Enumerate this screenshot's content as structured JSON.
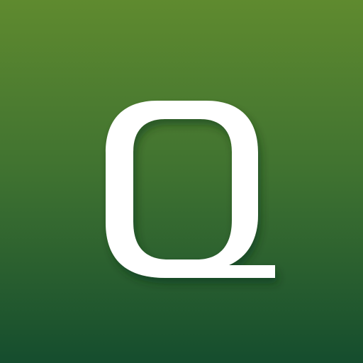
{
  "app_icon": {
    "letter": "Q",
    "icon_name": "q-letter-icon",
    "colors": {
      "background_top": "#5f8a2f",
      "background_middle": "#3f7230",
      "background_bottom": "#154d2e",
      "glyph": "#ffffff",
      "shadow": "#0b2c16"
    }
  }
}
